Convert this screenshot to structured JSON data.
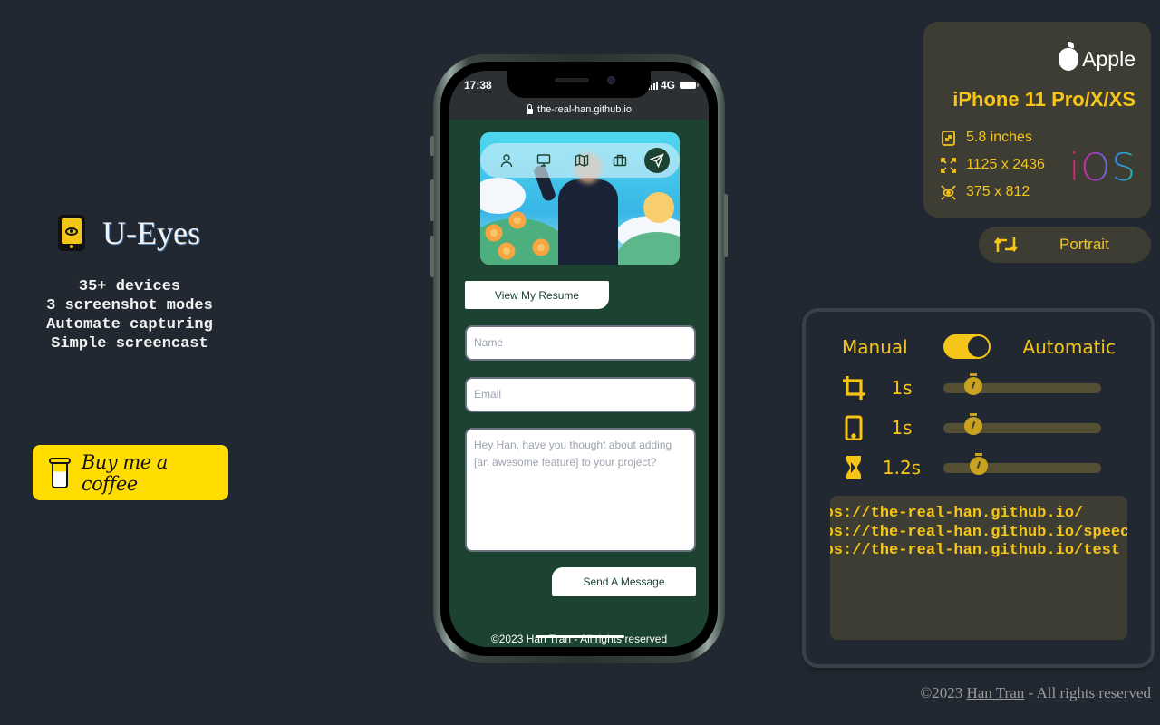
{
  "brand": {
    "title": "U-Eyes",
    "features": [
      "35+ devices",
      "3 screenshot modes",
      "Automate capturing",
      "Simple screencast"
    ],
    "coffee_label": "Buy me a coffee"
  },
  "phone": {
    "time": "17:38",
    "network": "4G",
    "url": "the-real-han.github.io",
    "nav_icons": [
      "user-icon",
      "desktop-icon",
      "map-icon",
      "briefcase-icon",
      "send-icon"
    ],
    "resume_label": "View My Resume",
    "name_placeholder": "Name",
    "email_placeholder": "Email",
    "message_placeholder": "Hey Han, have you thought about adding [an awesome feature] to your project?",
    "send_label": "Send A Message",
    "footer": "©2023 Han Tran - All rights reserved"
  },
  "device": {
    "brand": "Apple",
    "name": "iPhone 11 Pro/X/XS",
    "size": "5.8 inches",
    "resolution": "1125 x 2436",
    "viewport": "375 x 812",
    "os": "iOS",
    "orientation": "Portrait"
  },
  "capture": {
    "mode_manual": "Manual",
    "mode_automatic": "Automatic",
    "automatic_enabled": true,
    "sliders": [
      {
        "name": "crop-delay",
        "icon": "crop-icon",
        "label": "1s",
        "value_fraction": 0.15
      },
      {
        "name": "device-delay",
        "icon": "phone-icon",
        "label": "1s",
        "value_fraction": 0.15
      },
      {
        "name": "wait-delay",
        "icon": "hourglass-icon",
        "label": "1.2s",
        "value_fraction": 0.19
      }
    ],
    "urls": [
      "https://the-real-han.github.io/",
      "https://the-real-han.github.io/speech",
      "https://the-real-han.github.io/test"
    ]
  },
  "footer": {
    "prefix": "©2023 ",
    "author": "Han Tran",
    "suffix": " - All rights reserved"
  },
  "colors": {
    "background": "#222831",
    "accent": "#f5c518",
    "panel": "#3e3d33",
    "phone_screen": "#1c4331",
    "coffee": "#ffdd00"
  }
}
